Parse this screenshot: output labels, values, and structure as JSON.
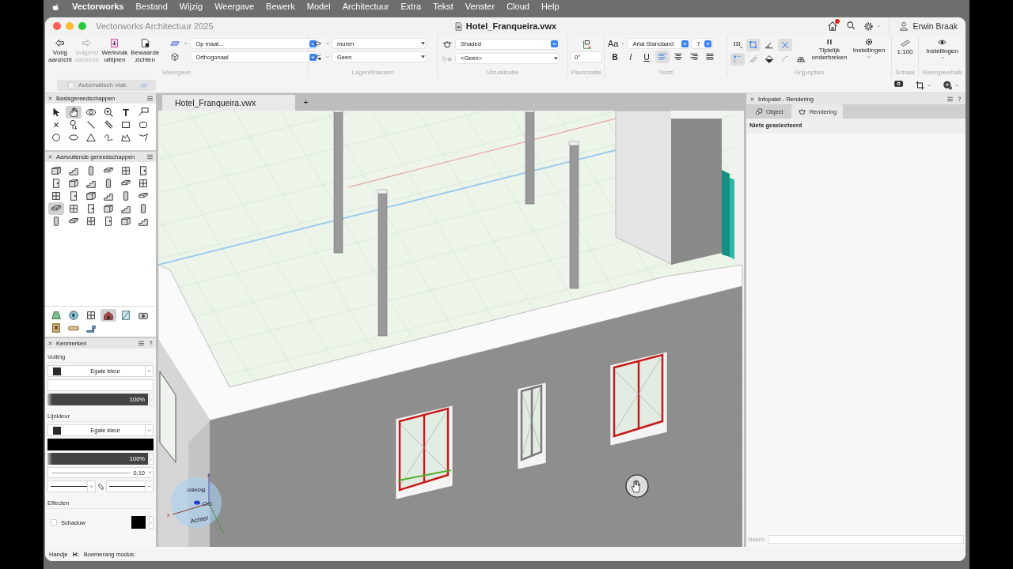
{
  "menu_bar": {
    "app_name": "Vectorworks",
    "items": [
      "Bestand",
      "Wijzig",
      "Weergave",
      "Bewerk",
      "Model",
      "Architectuur",
      "Extra",
      "Tekst",
      "Venster",
      "Cloud",
      "Help"
    ]
  },
  "window": {
    "title": "Vectorworks Architectuur 2025",
    "document": "Hotel_Franqueira.vwx",
    "home_badge": true,
    "user": "Erwin Braak"
  },
  "toolbar": {
    "view": {
      "label": "Weergave",
      "buttons": [
        {
          "label": "Vorig aanzicht",
          "disabled": false
        },
        {
          "label": "Volgend aanzicht",
          "disabled": true
        },
        {
          "label": "Werkvlak uitlijnen",
          "disabled": false
        },
        {
          "label": "Bewaarde zichten",
          "disabled": false
        }
      ],
      "selects": [
        "Op maat...",
        "Orthogonaal"
      ]
    },
    "layers": {
      "label": "Lagen/Klassen",
      "selects": [
        "muren",
        "Geen"
      ]
    },
    "visualization": {
      "label": "Visualisatie",
      "selects": [
        "Shaded",
        "<Geen>"
      ]
    },
    "plan_rotation": {
      "label": "Planrotatie",
      "value": "0°"
    },
    "text": {
      "label": "Tekst",
      "size_icon": "Aa",
      "font": "Arial Standaard",
      "size": "7",
      "styles": [
        {
          "kind": "bold",
          "label": "B",
          "selected": false
        },
        {
          "kind": "italic",
          "label": "I",
          "selected": false
        },
        {
          "kind": "underline",
          "label": "U",
          "selected": false
        }
      ],
      "alignments": [
        {
          "kind": "left",
          "selected": true
        },
        {
          "kind": "center",
          "selected": false
        },
        {
          "kind": "right",
          "selected": false
        },
        {
          "kind": "justify",
          "selected": false
        }
      ]
    },
    "snapping": {
      "label": "Grijpopties",
      "snaps": [
        {
          "selected": false,
          "disabled": false
        },
        {
          "selected": true,
          "disabled": false
        },
        {
          "selected": false,
          "disabled": false
        },
        {
          "selected": true,
          "disabled": false
        },
        {
          "selected": true,
          "disabled": false
        },
        {
          "selected": false,
          "disabled": false
        },
        {
          "selected": false,
          "disabled": false
        },
        {
          "selected": false,
          "disabled": true
        },
        {
          "selected": false,
          "disabled": false
        }
      ],
      "pause_label": "Tijdelijk onderbreken",
      "settings_label": "Instellingen"
    },
    "scale": {
      "label": "Schaal",
      "value": "1:100"
    },
    "view_bar": {
      "label": "Weergavebalk",
      "settings_label": "Instellingen"
    },
    "auto_plane": {
      "label": "Automatisch vlak",
      "checked": false,
      "disabled": true
    }
  },
  "palettes": {
    "basic": {
      "title": "Basisgereedschappen",
      "tools": [
        {
          "selected": false
        },
        {
          "selected": true
        },
        {
          "selected": false
        },
        {
          "selected": false
        },
        {
          "selected": false,
          "label": "T"
        },
        {
          "selected": false
        },
        {
          "selected": false
        },
        {
          "selected": false
        },
        {
          "selected": false
        },
        {
          "selected": false
        },
        {
          "selected": false
        },
        {
          "selected": false
        },
        {
          "selected": false
        },
        {
          "selected": false
        },
        {
          "selected": false
        },
        {
          "selected": false
        },
        {
          "selected": false
        },
        {
          "selected": false
        }
      ]
    },
    "extra": {
      "title": "Aanvullende gereedschappen",
      "tools": [
        {
          "selected": false
        },
        {
          "selected": false
        },
        {
          "selected": false
        },
        {
          "selected": false
        },
        {
          "selected": false
        },
        {
          "selected": false
        },
        {
          "selected": false
        },
        {
          "selected": false
        },
        {
          "selected": false
        },
        {
          "selected": false
        },
        {
          "selected": false
        },
        {
          "selected": false
        },
        {
          "selected": false
        },
        {
          "selected": false
        },
        {
          "selected": false
        },
        {
          "selected": false
        },
        {
          "selected": false
        },
        {
          "selected": false
        },
        {
          "selected": true
        },
        {
          "selected": false
        },
        {
          "selected": false
        },
        {
          "selected": false
        },
        {
          "selected": false
        },
        {
          "selected": false
        },
        {
          "selected": false
        },
        {
          "selected": false
        },
        {
          "selected": false
        },
        {
          "selected": false
        },
        {
          "selected": false
        },
        {
          "selected": false
        }
      ],
      "sets": [
        {
          "selected": false
        },
        {
          "selected": false
        },
        {
          "selected": false
        },
        {
          "selected": true
        },
        {
          "selected": false
        },
        {
          "selected": false
        },
        {
          "selected": false
        },
        {
          "selected": false
        },
        {
          "selected": false
        }
      ]
    }
  },
  "attributes": {
    "title": "Kenmerken",
    "fill_label": "Vulling",
    "fill_type": "Egale kleur",
    "fill_opacity": {
      "level": 1,
      "reading": "100%"
    },
    "line_label": "Lijnkleur",
    "line_type": "Egale kleur",
    "line_opacity": {
      "level": 1,
      "reading": "100%"
    },
    "line_thickness": "0,10",
    "effects_label": "Effecten",
    "shadow": {
      "label": "Schaduw",
      "checked": false
    }
  },
  "document_tabs": [
    {
      "label": "Hotel_Franqueira.vwx",
      "selected": true
    }
  ],
  "add_tab": "+",
  "viewport": {
    "cube_labels": [
      "Boven",
      "OG",
      "Achter"
    ],
    "axis_labels": [
      "z",
      "x"
    ]
  },
  "info_palette": {
    "title": "Infopalet - Rendering",
    "tabs": [
      {
        "label": "Object",
        "selected": false
      },
      {
        "label": "Rendering",
        "selected": true
      }
    ],
    "message": "Niets geselecteerd",
    "name_label": "Naam:"
  },
  "status_bar": {
    "tool": "Handje",
    "shortcut_key": "H:",
    "mode": "Boemerang modus:"
  }
}
